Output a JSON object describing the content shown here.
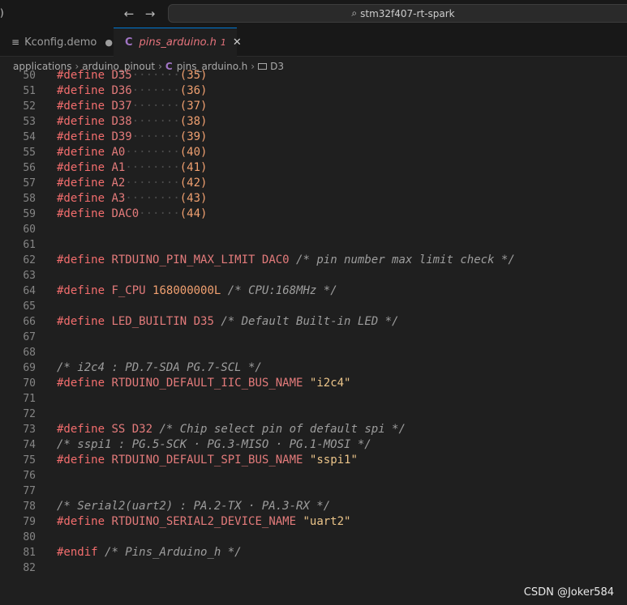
{
  "titlebar": {
    "left_fragment": ")",
    "back_icon": "arrow-left-icon",
    "forward_icon": "arrow-right-icon",
    "command_center": "stm32f407-rt-spark"
  },
  "tabs": [
    {
      "label": "Kconfig.demo",
      "icon": "file-lines-icon",
      "indicator": "●"
    },
    {
      "label": "pins_arduino.h",
      "icon": "c-language-icon",
      "badge": "1",
      "close": "✕"
    }
  ],
  "breadcrumb": {
    "items": [
      "applications",
      "arduino_pinout",
      "pins_arduino.h",
      "D3"
    ],
    "separator": "›"
  },
  "editor": {
    "lines": [
      {
        "n": "50",
        "t": [
          [
            "kw",
            "#define"
          ],
          [
            "p",
            " "
          ],
          [
            "id",
            "D35"
          ],
          [
            "ws",
            "·······"
          ],
          [
            "num",
            "(35)"
          ]
        ]
      },
      {
        "n": "51",
        "t": [
          [
            "kw",
            "#define"
          ],
          [
            "p",
            " "
          ],
          [
            "id",
            "D36"
          ],
          [
            "ws",
            "·······"
          ],
          [
            "num",
            "(36)"
          ]
        ]
      },
      {
        "n": "52",
        "t": [
          [
            "kw",
            "#define"
          ],
          [
            "p",
            " "
          ],
          [
            "id",
            "D37"
          ],
          [
            "ws",
            "·······"
          ],
          [
            "num",
            "(37)"
          ]
        ]
      },
      {
        "n": "53",
        "t": [
          [
            "kw",
            "#define"
          ],
          [
            "p",
            " "
          ],
          [
            "id",
            "D38"
          ],
          [
            "ws",
            "·······"
          ],
          [
            "num",
            "(38)"
          ]
        ]
      },
      {
        "n": "54",
        "t": [
          [
            "kw",
            "#define"
          ],
          [
            "p",
            " "
          ],
          [
            "id",
            "D39"
          ],
          [
            "ws",
            "·······"
          ],
          [
            "num",
            "(39)"
          ]
        ]
      },
      {
        "n": "55",
        "t": [
          [
            "kw",
            "#define"
          ],
          [
            "p",
            " "
          ],
          [
            "id",
            "A0"
          ],
          [
            "ws",
            "········"
          ],
          [
            "num",
            "(40)"
          ]
        ]
      },
      {
        "n": "56",
        "t": [
          [
            "kw",
            "#define"
          ],
          [
            "p",
            " "
          ],
          [
            "id",
            "A1"
          ],
          [
            "ws",
            "········"
          ],
          [
            "num",
            "(41)"
          ]
        ]
      },
      {
        "n": "57",
        "t": [
          [
            "kw",
            "#define"
          ],
          [
            "p",
            " "
          ],
          [
            "id",
            "A2"
          ],
          [
            "ws",
            "········"
          ],
          [
            "num",
            "(42)"
          ]
        ]
      },
      {
        "n": "58",
        "t": [
          [
            "kw",
            "#define"
          ],
          [
            "p",
            " "
          ],
          [
            "id",
            "A3"
          ],
          [
            "ws",
            "········"
          ],
          [
            "num",
            "(43)"
          ]
        ]
      },
      {
        "n": "59",
        "t": [
          [
            "kw",
            "#define"
          ],
          [
            "p",
            " "
          ],
          [
            "id",
            "DAC0"
          ],
          [
            "ws",
            "······"
          ],
          [
            "num",
            "(44)"
          ]
        ]
      },
      {
        "n": "60",
        "t": []
      },
      {
        "n": "61",
        "t": []
      },
      {
        "n": "62",
        "t": [
          [
            "kw",
            "#define"
          ],
          [
            "p",
            " "
          ],
          [
            "id",
            "RTDUINO_PIN_MAX_LIMIT DAC0"
          ],
          [
            "p",
            " "
          ],
          [
            "cm",
            "/* pin number max limit check */"
          ]
        ]
      },
      {
        "n": "63",
        "t": []
      },
      {
        "n": "64",
        "t": [
          [
            "kw",
            "#define"
          ],
          [
            "p",
            " "
          ],
          [
            "id",
            "F_CPU"
          ],
          [
            "p",
            " "
          ],
          [
            "num",
            "168000000L"
          ],
          [
            "p",
            " "
          ],
          [
            "cm",
            "/* CPU:168MHz */"
          ]
        ]
      },
      {
        "n": "65",
        "t": []
      },
      {
        "n": "66",
        "t": [
          [
            "kw",
            "#define"
          ],
          [
            "p",
            " "
          ],
          [
            "id",
            "LED_BUILTIN D35"
          ],
          [
            "p",
            " "
          ],
          [
            "cm",
            "/* Default Built-in LED */"
          ]
        ]
      },
      {
        "n": "67",
        "t": []
      },
      {
        "n": "68",
        "t": []
      },
      {
        "n": "69",
        "t": [
          [
            "cm",
            "/* i2c4 : PD.7-SDA PG.7-SCL */"
          ]
        ]
      },
      {
        "n": "70",
        "t": [
          [
            "kw",
            "#define"
          ],
          [
            "p",
            " "
          ],
          [
            "id",
            "RTDUINO_DEFAULT_IIC_BUS_NAME"
          ],
          [
            "p",
            " "
          ],
          [
            "str",
            "\"i2c4\""
          ]
        ]
      },
      {
        "n": "71",
        "t": []
      },
      {
        "n": "72",
        "t": []
      },
      {
        "n": "73",
        "t": [
          [
            "kw",
            "#define"
          ],
          [
            "p",
            " "
          ],
          [
            "id",
            "SS D32"
          ],
          [
            "p",
            " "
          ],
          [
            "cm",
            "/* Chip select pin of default spi */"
          ]
        ]
      },
      {
        "n": "74",
        "t": [
          [
            "cm",
            "/* sspi1 : PG.5-SCK · PG.3-MISO · PG.1-MOSI */"
          ]
        ]
      },
      {
        "n": "75",
        "t": [
          [
            "kw",
            "#define"
          ],
          [
            "p",
            " "
          ],
          [
            "id",
            "RTDUINO_DEFAULT_SPI_BUS_NAME"
          ],
          [
            "p",
            " "
          ],
          [
            "str",
            "\"sspi1\""
          ]
        ]
      },
      {
        "n": "76",
        "t": []
      },
      {
        "n": "77",
        "t": []
      },
      {
        "n": "78",
        "t": [
          [
            "cm",
            "/* Serial2(uart2) : PA.2-TX · PA.3-RX */"
          ]
        ]
      },
      {
        "n": "79",
        "t": [
          [
            "kw",
            "#define"
          ],
          [
            "p",
            " "
          ],
          [
            "id",
            "RTDUINO_SERIAL2_DEVICE_NAME"
          ],
          [
            "p",
            " "
          ],
          [
            "str",
            "\"uart2\""
          ]
        ]
      },
      {
        "n": "80",
        "t": []
      },
      {
        "n": "81",
        "t": [
          [
            "kw",
            "#endif"
          ],
          [
            "p",
            " "
          ],
          [
            "cm",
            "/* Pins_Arduino_h */"
          ]
        ]
      },
      {
        "n": "82",
        "t": []
      }
    ]
  },
  "watermark": "CSDN @Joker584",
  "colors": {
    "background": "#1f1f1f",
    "keyword": "#f26d6d",
    "identifier": "#e37b7b",
    "number": "#f0a070",
    "string": "#ecc58a",
    "comment": "#9d9d9d",
    "line_number": "#858585",
    "active_tab_border": "#0078d4"
  }
}
